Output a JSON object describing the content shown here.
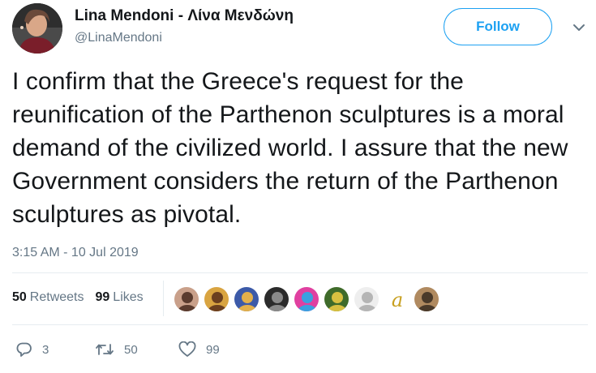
{
  "author": {
    "name": "Lina Mendoni - Λίνα Μενδώνη",
    "handle": "@LinaMendoni",
    "avatar_icon": "profile-photo"
  },
  "follow_button": {
    "label": "Follow"
  },
  "menu_icon": "chevron-down-icon",
  "tweet": {
    "text": "I confirm that the Greece's request for the reunification of the Parthenon sculptures is a moral demand of the civilized world. I assure that the new Government considers the return of the Parthenon sculptures as pivotal.",
    "timestamp": "3:15 AM - 10 Jul 2019"
  },
  "stats": {
    "retweets_count": "50",
    "retweets_label": "Retweets",
    "likes_count": "99",
    "likes_label": "Likes"
  },
  "likers": [
    {
      "name": "liker-avatar-1",
      "colors": [
        "#c9a08a",
        "#5a3b2e"
      ]
    },
    {
      "name": "liker-avatar-2",
      "colors": [
        "#d9a441",
        "#6b3f1f"
      ]
    },
    {
      "name": "liker-avatar-3",
      "colors": [
        "#3c5aa8",
        "#e3b04b"
      ]
    },
    {
      "name": "liker-avatar-4",
      "colors": [
        "#2b2b2b",
        "#8a8a8a"
      ]
    },
    {
      "name": "liker-avatar-5",
      "colors": [
        "#e040a0",
        "#3aa0e0"
      ]
    },
    {
      "name": "liker-avatar-6",
      "colors": [
        "#3f6b2a",
        "#d8c040"
      ]
    },
    {
      "name": "liker-avatar-7",
      "colors": [
        "#eeeeee",
        "#b5b5b5"
      ]
    },
    {
      "name": "liker-avatar-8",
      "colors": [
        "#ffffff",
        "#c8a020"
      ]
    },
    {
      "name": "liker-avatar-9",
      "colors": [
        "#b08a60",
        "#4a3a2a"
      ]
    }
  ],
  "liker_letter": "a",
  "actions": {
    "reply_count": "3",
    "retweet_count": "50",
    "like_count": "99"
  },
  "colors": {
    "accent": "#1da1f2",
    "text": "#14171a",
    "muted": "#657786",
    "divider": "#e6ecf0"
  }
}
